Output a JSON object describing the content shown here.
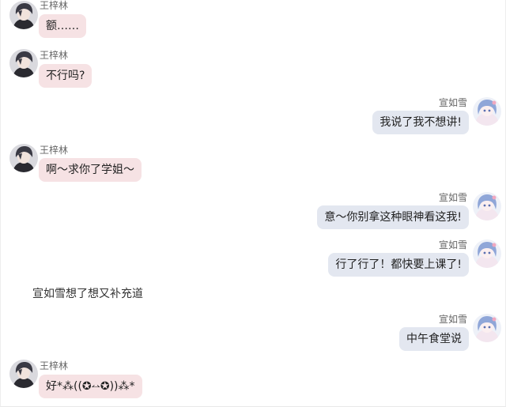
{
  "users": {
    "left_name": "王梓林",
    "right_name": "宣如雪"
  },
  "messages": [
    {
      "side": "left",
      "text": "额……"
    },
    {
      "side": "left",
      "text": "不行吗?"
    },
    {
      "side": "right",
      "text": "我说了我不想讲!"
    },
    {
      "side": "left",
      "text": "啊～求你了学姐～"
    },
    {
      "side": "right",
      "text": "意～你别拿这种眼神看这我!"
    },
    {
      "side": "right",
      "text": "行了行了！都快要上课了!"
    },
    {
      "side": "narration",
      "text": "宣如雪想了想又补充道"
    },
    {
      "side": "right",
      "text": "中午食堂说"
    },
    {
      "side": "left",
      "text": "好*⁂((✪⥎✪))⁂*"
    }
  ],
  "colors": {
    "left_bubble": "#f6e2e4",
    "right_bubble": "#e3e7f0"
  }
}
